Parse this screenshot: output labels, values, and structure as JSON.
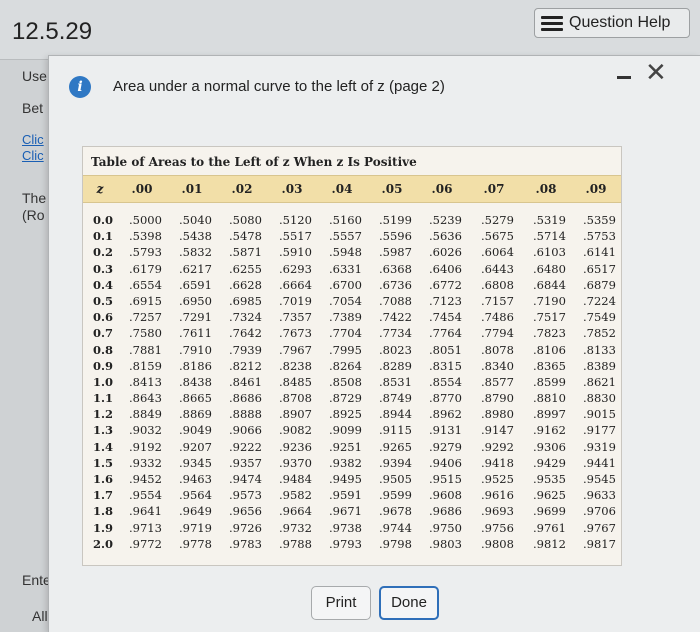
{
  "header": {
    "problem_id": "12.5.29",
    "help_label": "Question Help"
  },
  "background": {
    "use": "Use",
    "bet": "Bet",
    "click1": "Clic",
    "click2": "Clic",
    "the": "The",
    "ro": "(Ro",
    "ente": "Ente",
    "allp": "All p"
  },
  "dialog": {
    "title": "Area under a normal curve to the left of z (page 2)",
    "close_glyph": "✕",
    "info_glyph": "i",
    "print_label": "Print",
    "done_label": "Done"
  },
  "table": {
    "title": "Table of Areas to the Left of z When z Is Positive",
    "z_header": "z",
    "columns": [
      ".00",
      ".01",
      ".02",
      ".03",
      ".04",
      ".05",
      ".06",
      ".07",
      ".08",
      ".09"
    ],
    "rows": [
      {
        "z": "0.0",
        "v": [
          ".5000",
          ".5040",
          ".5080",
          ".5120",
          ".5160",
          ".5199",
          ".5239",
          ".5279",
          ".5319",
          ".5359"
        ]
      },
      {
        "z": "0.1",
        "v": [
          ".5398",
          ".5438",
          ".5478",
          ".5517",
          ".5557",
          ".5596",
          ".5636",
          ".5675",
          ".5714",
          ".5753"
        ]
      },
      {
        "z": "0.2",
        "v": [
          ".5793",
          ".5832",
          ".5871",
          ".5910",
          ".5948",
          ".5987",
          ".6026",
          ".6064",
          ".6103",
          ".6141"
        ]
      },
      {
        "z": "0.3",
        "v": [
          ".6179",
          ".6217",
          ".6255",
          ".6293",
          ".6331",
          ".6368",
          ".6406",
          ".6443",
          ".6480",
          ".6517"
        ]
      },
      {
        "z": "0.4",
        "v": [
          ".6554",
          ".6591",
          ".6628",
          ".6664",
          ".6700",
          ".6736",
          ".6772",
          ".6808",
          ".6844",
          ".6879"
        ]
      },
      {
        "z": "0.5",
        "v": [
          ".6915",
          ".6950",
          ".6985",
          ".7019",
          ".7054",
          ".7088",
          ".7123",
          ".7157",
          ".7190",
          ".7224"
        ]
      },
      {
        "z": "0.6",
        "v": [
          ".7257",
          ".7291",
          ".7324",
          ".7357",
          ".7389",
          ".7422",
          ".7454",
          ".7486",
          ".7517",
          ".7549"
        ]
      },
      {
        "z": "0.7",
        "v": [
          ".7580",
          ".7611",
          ".7642",
          ".7673",
          ".7704",
          ".7734",
          ".7764",
          ".7794",
          ".7823",
          ".7852"
        ]
      },
      {
        "z": "0.8",
        "v": [
          ".7881",
          ".7910",
          ".7939",
          ".7967",
          ".7995",
          ".8023",
          ".8051",
          ".8078",
          ".8106",
          ".8133"
        ]
      },
      {
        "z": "0.9",
        "v": [
          ".8159",
          ".8186",
          ".8212",
          ".8238",
          ".8264",
          ".8289",
          ".8315",
          ".8340",
          ".8365",
          ".8389"
        ]
      },
      {
        "z": "1.0",
        "v": [
          ".8413",
          ".8438",
          ".8461",
          ".8485",
          ".8508",
          ".8531",
          ".8554",
          ".8577",
          ".8599",
          ".8621"
        ]
      },
      {
        "z": "1.1",
        "v": [
          ".8643",
          ".8665",
          ".8686",
          ".8708",
          ".8729",
          ".8749",
          ".8770",
          ".8790",
          ".8810",
          ".8830"
        ]
      },
      {
        "z": "1.2",
        "v": [
          ".8849",
          ".8869",
          ".8888",
          ".8907",
          ".8925",
          ".8944",
          ".8962",
          ".8980",
          ".8997",
          ".9015"
        ]
      },
      {
        "z": "1.3",
        "v": [
          ".9032",
          ".9049",
          ".9066",
          ".9082",
          ".9099",
          ".9115",
          ".9131",
          ".9147",
          ".9162",
          ".9177"
        ]
      },
      {
        "z": "1.4",
        "v": [
          ".9192",
          ".9207",
          ".9222",
          ".9236",
          ".9251",
          ".9265",
          ".9279",
          ".9292",
          ".9306",
          ".9319"
        ]
      },
      {
        "z": "1.5",
        "v": [
          ".9332",
          ".9345",
          ".9357",
          ".9370",
          ".9382",
          ".9394",
          ".9406",
          ".9418",
          ".9429",
          ".9441"
        ]
      },
      {
        "z": "1.6",
        "v": [
          ".9452",
          ".9463",
          ".9474",
          ".9484",
          ".9495",
          ".9505",
          ".9515",
          ".9525",
          ".9535",
          ".9545"
        ]
      },
      {
        "z": "1.7",
        "v": [
          ".9554",
          ".9564",
          ".9573",
          ".9582",
          ".9591",
          ".9599",
          ".9608",
          ".9616",
          ".9625",
          ".9633"
        ]
      },
      {
        "z": "1.8",
        "v": [
          ".9641",
          ".9649",
          ".9656",
          ".9664",
          ".9671",
          ".9678",
          ".9686",
          ".9693",
          ".9699",
          ".9706"
        ]
      },
      {
        "z": "1.9",
        "v": [
          ".9713",
          ".9719",
          ".9726",
          ".9732",
          ".9738",
          ".9744",
          ".9750",
          ".9756",
          ".9761",
          ".9767"
        ]
      },
      {
        "z": "2.0",
        "v": [
          ".9772",
          ".9778",
          ".9783",
          ".9788",
          ".9793",
          ".9798",
          ".9803",
          ".9808",
          ".9812",
          ".9817"
        ]
      }
    ]
  }
}
